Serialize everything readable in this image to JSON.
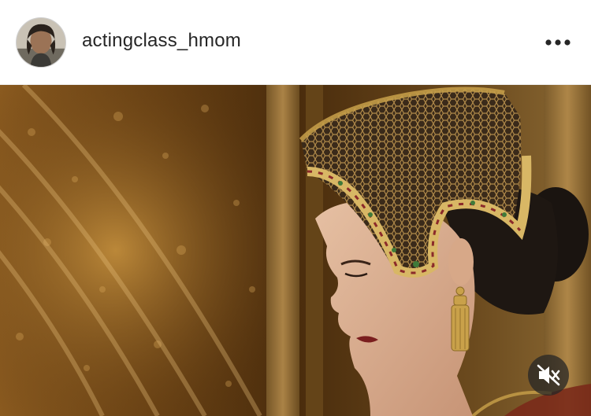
{
  "post": {
    "username": "actingclass_hmom",
    "avatar_icon": "profile-avatar",
    "more_icon": "more-horizontal-icon",
    "mute_icon": "speaker-muted-icon"
  },
  "colors": {
    "text": "#262626",
    "divider": "#efefef",
    "overlay": "#262626"
  }
}
